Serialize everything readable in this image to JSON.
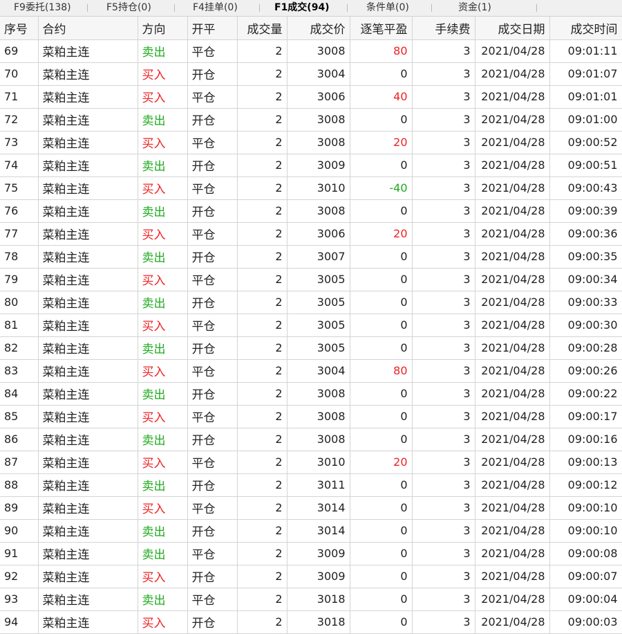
{
  "tabs": [
    {
      "label": "F9委托(138)",
      "active": false
    },
    {
      "label": "F5持仓(0)",
      "active": false
    },
    {
      "label": "F4挂单(0)",
      "active": false
    },
    {
      "label": "F1成交(94)",
      "active": true
    },
    {
      "label": "条件单(0)",
      "active": false
    },
    {
      "label": "资金(1)",
      "active": false
    }
  ],
  "colors": {
    "sell": "#1faa1f",
    "buy": "#ee2222",
    "profit": "#ee2222",
    "loss": "#1faa1f"
  },
  "columns": [
    "序号",
    "合约",
    "方向",
    "开平",
    "成交量",
    "成交价",
    "逐笔平盈",
    "手续费",
    "成交日期",
    "成交时间"
  ],
  "rows": [
    {
      "seq": "69",
      "contract": "菜粕主连",
      "direction": "卖出",
      "offset": "平仓",
      "volume": "2",
      "price": "3008",
      "pnl": "80",
      "fee": "3",
      "date": "2021/04/28",
      "time": "09:01:11"
    },
    {
      "seq": "70",
      "contract": "菜粕主连",
      "direction": "买入",
      "offset": "开仓",
      "volume": "2",
      "price": "3004",
      "pnl": "0",
      "fee": "3",
      "date": "2021/04/28",
      "time": "09:01:07"
    },
    {
      "seq": "71",
      "contract": "菜粕主连",
      "direction": "买入",
      "offset": "平仓",
      "volume": "2",
      "price": "3006",
      "pnl": "40",
      "fee": "3",
      "date": "2021/04/28",
      "time": "09:01:01"
    },
    {
      "seq": "72",
      "contract": "菜粕主连",
      "direction": "卖出",
      "offset": "开仓",
      "volume": "2",
      "price": "3008",
      "pnl": "0",
      "fee": "3",
      "date": "2021/04/28",
      "time": "09:01:00"
    },
    {
      "seq": "73",
      "contract": "菜粕主连",
      "direction": "买入",
      "offset": "平仓",
      "volume": "2",
      "price": "3008",
      "pnl": "20",
      "fee": "3",
      "date": "2021/04/28",
      "time": "09:00:52"
    },
    {
      "seq": "74",
      "contract": "菜粕主连",
      "direction": "卖出",
      "offset": "开仓",
      "volume": "2",
      "price": "3009",
      "pnl": "0",
      "fee": "3",
      "date": "2021/04/28",
      "time": "09:00:51"
    },
    {
      "seq": "75",
      "contract": "菜粕主连",
      "direction": "买入",
      "offset": "平仓",
      "volume": "2",
      "price": "3010",
      "pnl": "-40",
      "fee": "3",
      "date": "2021/04/28",
      "time": "09:00:43"
    },
    {
      "seq": "76",
      "contract": "菜粕主连",
      "direction": "卖出",
      "offset": "开仓",
      "volume": "2",
      "price": "3008",
      "pnl": "0",
      "fee": "3",
      "date": "2021/04/28",
      "time": "09:00:39"
    },
    {
      "seq": "77",
      "contract": "菜粕主连",
      "direction": "买入",
      "offset": "平仓",
      "volume": "2",
      "price": "3006",
      "pnl": "20",
      "fee": "3",
      "date": "2021/04/28",
      "time": "09:00:36"
    },
    {
      "seq": "78",
      "contract": "菜粕主连",
      "direction": "卖出",
      "offset": "开仓",
      "volume": "2",
      "price": "3007",
      "pnl": "0",
      "fee": "3",
      "date": "2021/04/28",
      "time": "09:00:35"
    },
    {
      "seq": "79",
      "contract": "菜粕主连",
      "direction": "买入",
      "offset": "平仓",
      "volume": "2",
      "price": "3005",
      "pnl": "0",
      "fee": "3",
      "date": "2021/04/28",
      "time": "09:00:34"
    },
    {
      "seq": "80",
      "contract": "菜粕主连",
      "direction": "卖出",
      "offset": "开仓",
      "volume": "2",
      "price": "3005",
      "pnl": "0",
      "fee": "3",
      "date": "2021/04/28",
      "time": "09:00:33"
    },
    {
      "seq": "81",
      "contract": "菜粕主连",
      "direction": "买入",
      "offset": "平仓",
      "volume": "2",
      "price": "3005",
      "pnl": "0",
      "fee": "3",
      "date": "2021/04/28",
      "time": "09:00:30"
    },
    {
      "seq": "82",
      "contract": "菜粕主连",
      "direction": "卖出",
      "offset": "开仓",
      "volume": "2",
      "price": "3005",
      "pnl": "0",
      "fee": "3",
      "date": "2021/04/28",
      "time": "09:00:28"
    },
    {
      "seq": "83",
      "contract": "菜粕主连",
      "direction": "买入",
      "offset": "平仓",
      "volume": "2",
      "price": "3004",
      "pnl": "80",
      "fee": "3",
      "date": "2021/04/28",
      "time": "09:00:26"
    },
    {
      "seq": "84",
      "contract": "菜粕主连",
      "direction": "卖出",
      "offset": "开仓",
      "volume": "2",
      "price": "3008",
      "pnl": "0",
      "fee": "3",
      "date": "2021/04/28",
      "time": "09:00:22"
    },
    {
      "seq": "85",
      "contract": "菜粕主连",
      "direction": "买入",
      "offset": "平仓",
      "volume": "2",
      "price": "3008",
      "pnl": "0",
      "fee": "3",
      "date": "2021/04/28",
      "time": "09:00:17"
    },
    {
      "seq": "86",
      "contract": "菜粕主连",
      "direction": "卖出",
      "offset": "开仓",
      "volume": "2",
      "price": "3008",
      "pnl": "0",
      "fee": "3",
      "date": "2021/04/28",
      "time": "09:00:16"
    },
    {
      "seq": "87",
      "contract": "菜粕主连",
      "direction": "买入",
      "offset": "平仓",
      "volume": "2",
      "price": "3010",
      "pnl": "20",
      "fee": "3",
      "date": "2021/04/28",
      "time": "09:00:13"
    },
    {
      "seq": "88",
      "contract": "菜粕主连",
      "direction": "卖出",
      "offset": "开仓",
      "volume": "2",
      "price": "3011",
      "pnl": "0",
      "fee": "3",
      "date": "2021/04/28",
      "time": "09:00:12"
    },
    {
      "seq": "89",
      "contract": "菜粕主连",
      "direction": "买入",
      "offset": "平仓",
      "volume": "2",
      "price": "3014",
      "pnl": "0",
      "fee": "3",
      "date": "2021/04/28",
      "time": "09:00:10"
    },
    {
      "seq": "90",
      "contract": "菜粕主连",
      "direction": "卖出",
      "offset": "开仓",
      "volume": "2",
      "price": "3014",
      "pnl": "0",
      "fee": "3",
      "date": "2021/04/28",
      "time": "09:00:10"
    },
    {
      "seq": "91",
      "contract": "菜粕主连",
      "direction": "卖出",
      "offset": "平仓",
      "volume": "2",
      "price": "3009",
      "pnl": "0",
      "fee": "3",
      "date": "2021/04/28",
      "time": "09:00:08"
    },
    {
      "seq": "92",
      "contract": "菜粕主连",
      "direction": "买入",
      "offset": "开仓",
      "volume": "2",
      "price": "3009",
      "pnl": "0",
      "fee": "3",
      "date": "2021/04/28",
      "time": "09:00:07"
    },
    {
      "seq": "93",
      "contract": "菜粕主连",
      "direction": "卖出",
      "offset": "平仓",
      "volume": "2",
      "price": "3018",
      "pnl": "0",
      "fee": "3",
      "date": "2021/04/28",
      "time": "09:00:04"
    },
    {
      "seq": "94",
      "contract": "菜粕主连",
      "direction": "买入",
      "offset": "开仓",
      "volume": "2",
      "price": "3018",
      "pnl": "0",
      "fee": "3",
      "date": "2021/04/28",
      "time": "09:00:03"
    }
  ]
}
